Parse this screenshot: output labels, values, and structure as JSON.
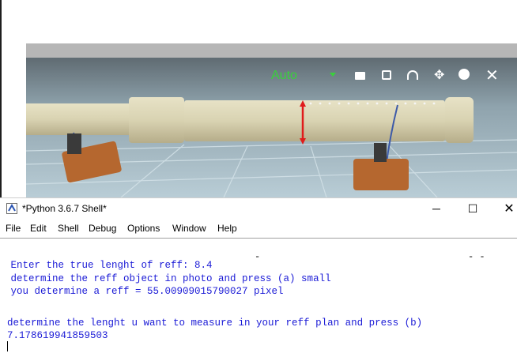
{
  "viewer": {
    "mode_label": "Auto",
    "toolbar_icons": [
      "dropdown-arrow-icon",
      "camera-icon",
      "snapshot-icon",
      "headset-icon",
      "move-icon",
      "palette-icon",
      "close-icon"
    ],
    "accent_green": "#39d13b",
    "marker_color": "#e01b1b"
  },
  "shell": {
    "title": "*Python 3.6.7 Shell*",
    "menu": [
      "File",
      "Edit",
      "Shell",
      "Debug",
      "Options",
      "Window",
      "Help"
    ],
    "lines": [
      " Enter the true lenght of reff: 8.4",
      " determine the reff object in photo and press (a) small",
      " you determine a reff = 55.00909015790027 pixel",
      "determine the lenght u want to measure in your reff plan and press (b)",
      "7.178619941859503"
    ],
    "top_marks": [
      "-",
      "- -"
    ],
    "text_color": "#1a1ad6"
  }
}
